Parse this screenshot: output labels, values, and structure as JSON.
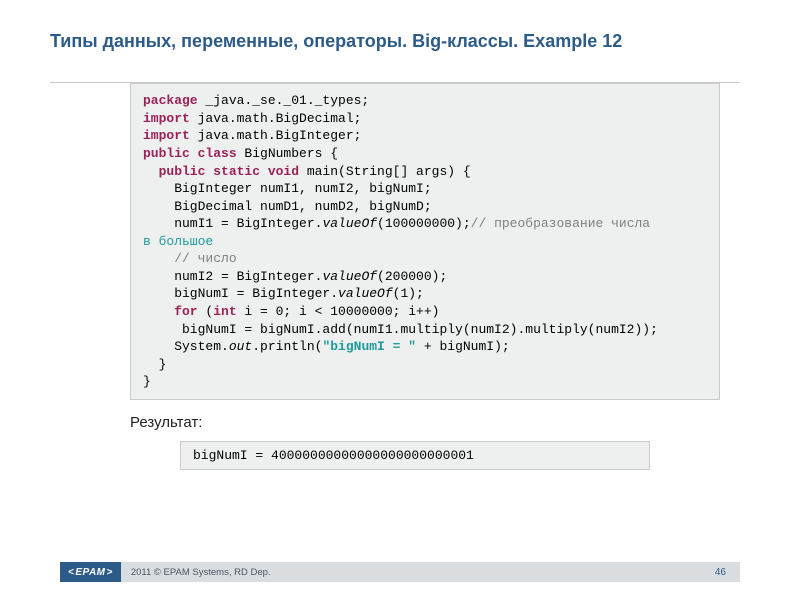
{
  "slide": {
    "title": "Типы данных, переменные, операторы. Big-классы. Example 12",
    "code": {
      "l1a": "package",
      "l1b": " _java._se._01._types;",
      "l2a": "import",
      "l2b": " java.math.BigDecimal;",
      "l3a": "import",
      "l3b": " java.math.BigInteger;",
      "l4a": "public class",
      "l4b": " BigNumbers {",
      "l5a": "  public static void",
      "l5b": " main(String[] args) {",
      "l6": "    BigInteger numI1, numI2, bigNumI;",
      "l7": "    BigDecimal numD1, numD2, bigNumD;",
      "l8a": "    numI1 = BigInteger.",
      "l8b": "valueOf",
      "l8c": "(100000000);",
      "l8d": "// преобразование числа",
      "l9": "в большое",
      "l10": "    // число",
      "l11a": "    numI2 = BigInteger.",
      "l11b": "valueOf",
      "l11c": "(200000);",
      "l12a": "    bigNumI = BigInteger.",
      "l12b": "valueOf",
      "l12c": "(1);",
      "l13a": "    for",
      "l13b": " (",
      "l13c": "int",
      "l13d": " i = 0; i < 10000000; i++)",
      "l14": "     bigNumI = bigNumI.add(numI1.multiply(numI2).multiply(numI2));",
      "l15a": "    System.",
      "l15b": "out",
      "l15c": ".println(",
      "l15d": "\"bigNumI = \"",
      "l15e": " + bigNumI);",
      "l16": "  }",
      "l17": "}"
    },
    "result_label": "Результат:",
    "result_value": "bigNumI = 40000000000000000000000001"
  },
  "footer": {
    "logo": "EPAM",
    "copyright": "2011 © EPAM Systems, RD Dep.",
    "page": "46"
  }
}
